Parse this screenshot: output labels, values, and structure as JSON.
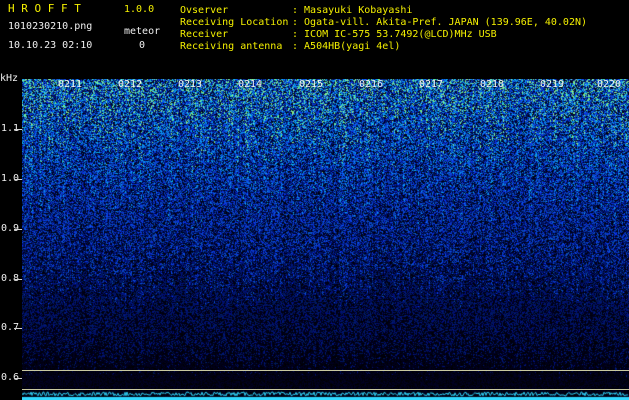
{
  "app": {
    "title": "H R O F F T",
    "version": "1.0.0",
    "filename": "1010230210.png",
    "datetime": "10.10.23 02:10",
    "meteor_label": "meteor",
    "meteor_count": "0"
  },
  "info": [
    {
      "label": "Ovserver",
      "value": ": Masayuki Kobayashi"
    },
    {
      "label": "Receiving Location",
      "value": ": Ogata-vill. Akita-Pref. JAPAN (139.96E, 40.02N)"
    },
    {
      "label": "Receiver",
      "value": ": ICOM IC-575 53.7492(@LCD)MHz USB"
    },
    {
      "label": "Receiving antenna",
      "value": ": A504HB(yagi 4el)"
    }
  ],
  "axis": {
    "unit": "kHz",
    "y_labels": [
      "1.1",
      "1.0",
      "0.9",
      "0.8",
      "0.7",
      "0.6"
    ],
    "time_labels": [
      "0211",
      "0212",
      "0213",
      "0214",
      "0215",
      "0216",
      "0217",
      "0218",
      "0219",
      "0220"
    ]
  },
  "colors": {
    "background": "#000000",
    "text_yellow": "#f4f000",
    "text_white": "#f0f0f0",
    "signal_high": "#7cf07c",
    "signal_mid": "#2a5cff",
    "signal_low": "#0a1a6a",
    "baseline": "#30d8ff"
  }
}
